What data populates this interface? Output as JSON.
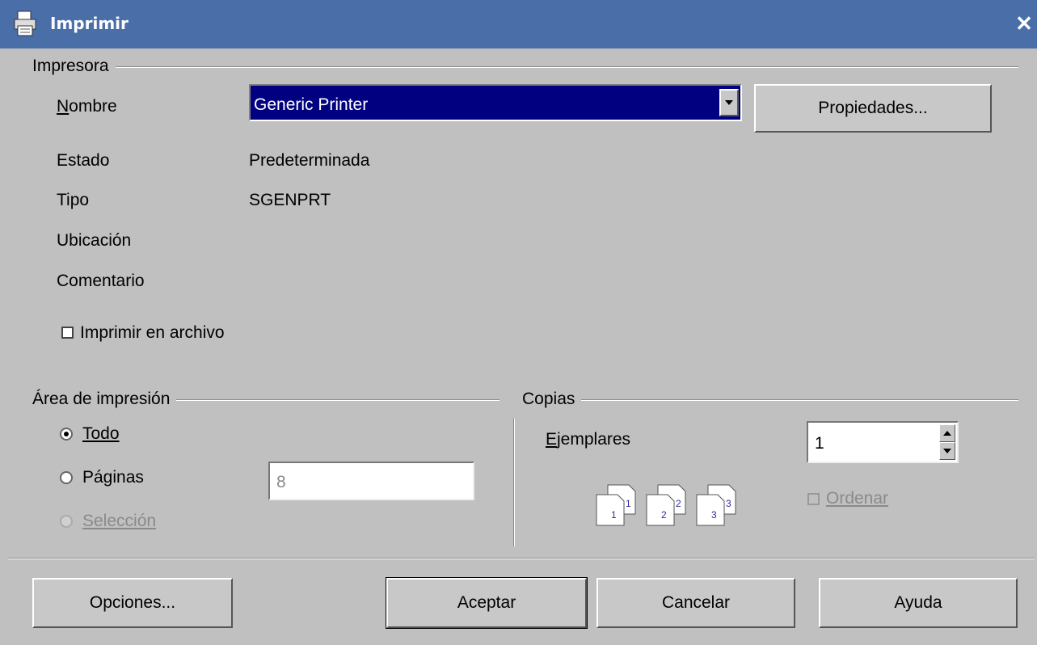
{
  "window": {
    "title": "Imprimir",
    "close": "✕"
  },
  "printer": {
    "section_label": "Impresora",
    "name_label": "Nombre",
    "name_value": "Generic Printer",
    "properties_button": "Propiedades...",
    "status_label": "Estado",
    "status_value": "Predeterminada",
    "type_label": "Tipo",
    "type_value": "SGENPRT",
    "location_label": "Ubicación",
    "comment_label": "Comentario",
    "print_to_file_label": "Imprimir en archivo"
  },
  "print_area": {
    "section_label": "Área de impresión",
    "all_label": "Todo",
    "pages_label": "Páginas",
    "pages_value": "8",
    "selection_label": "Selección"
  },
  "copies": {
    "section_label": "Copias",
    "count_label": "Ejemplares",
    "count_value": "1",
    "collate_label": "Ordenar",
    "collate_icons": [
      "1",
      "2",
      "3"
    ]
  },
  "buttons": {
    "options": "Opciones...",
    "accept": "Aceptar",
    "cancel": "Cancelar",
    "help": "Ayuda"
  }
}
